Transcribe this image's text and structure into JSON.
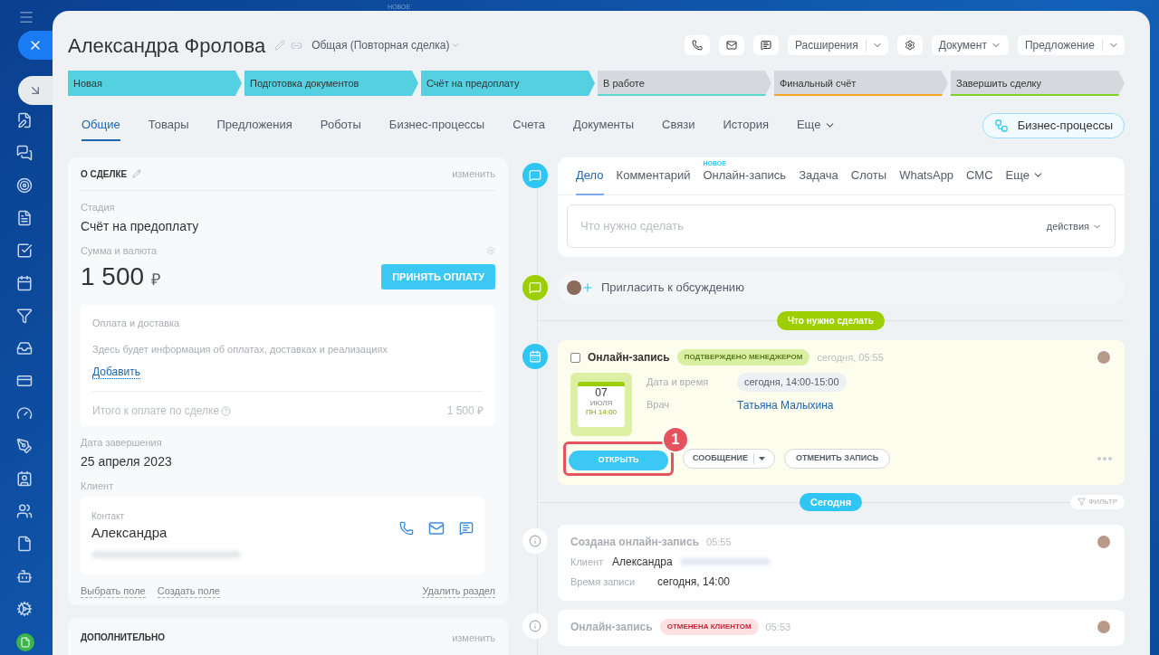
{
  "background_label": "НОВОЕ",
  "header": {
    "title": "Александра Фролова",
    "category": "Общая (Повторная сделка)",
    "toolbar": [
      {
        "kind": "icon"
      },
      {
        "kind": "icon"
      },
      {
        "kind": "icon"
      },
      {
        "kind": "split",
        "label": "Расширения"
      },
      {
        "kind": "icon"
      },
      {
        "kind": "dropdown",
        "label": "Документ"
      },
      {
        "kind": "split",
        "label": "Предложение"
      }
    ]
  },
  "stages": [
    {
      "label": "Новая",
      "passed": true,
      "color": "#55d0e0"
    },
    {
      "label": "Подготовка документов",
      "passed": true,
      "color": "#55d0e0"
    },
    {
      "label": "Счёт на предоплату",
      "passed": true,
      "color": "#55d0e0"
    },
    {
      "label": "В работе",
      "passed": false,
      "color": "#5ad8d0"
    },
    {
      "label": "Финальный счёт",
      "passed": false,
      "color": "#f5a623"
    },
    {
      "label": "Завершить сделку",
      "passed": false,
      "color": "#7ed321"
    }
  ],
  "tabs": [
    {
      "label": "Общие",
      "selected": true
    },
    {
      "label": "Товары",
      "selected": false
    },
    {
      "label": "Предложения",
      "selected": false
    },
    {
      "label": "Роботы",
      "selected": false
    },
    {
      "label": "Бизнес-процессы",
      "selected": false
    },
    {
      "label": "Счета",
      "selected": false
    },
    {
      "label": "Документы",
      "selected": false
    },
    {
      "label": "Связи",
      "selected": false
    },
    {
      "label": "История",
      "selected": false
    },
    {
      "label": "Еще",
      "selected": false,
      "kind": "more"
    }
  ],
  "process_button": "Бизнес-процессы",
  "about": {
    "title": "О СДЕЛКЕ",
    "edit_link": "изменить",
    "stage_label": "Стадия",
    "stage_value": "Счёт на предоплату",
    "amount_label": "Сумма и валюта",
    "amount": "1 500",
    "currency": "₽",
    "pay_button": "ПРИНЯТЬ ОПЛАТУ",
    "payment": {
      "title": "Оплата и доставка",
      "info": "Здесь будет информация об оплатах, доставках и реализациях",
      "add_link": "Добавить",
      "total_label": "Итого к оплате по сделке",
      "total": "1 500 ₽"
    },
    "close_date_label": "Дата завершения",
    "close_date": "25 апреля 2023",
    "client_label": "Клиент",
    "contact": {
      "label": "Контакт",
      "name": "Александра"
    },
    "footer_links": [
      "Выбрать поле",
      "Создать поле"
    ],
    "delete_link": "Удалить раздел"
  },
  "extra": {
    "title": "ДОПОЛНИТЕЛЬНО",
    "edit_link": "изменить"
  },
  "composer": {
    "tabs": [
      {
        "label": "Дело",
        "selected": true
      },
      {
        "label": "Комментарий",
        "selected": false
      },
      {
        "label": "Онлайн-запись",
        "selected": false,
        "badge": "НОВОЕ"
      },
      {
        "label": "Задача",
        "selected": false
      },
      {
        "label": "Слоты",
        "selected": false
      },
      {
        "label": "WhatsApp",
        "selected": false
      },
      {
        "label": "СМС",
        "selected": false
      },
      {
        "label": "Еще",
        "selected": false,
        "kind": "more"
      }
    ],
    "placeholder": "Что нужно сделать",
    "actions": "действия"
  },
  "invite": "Пригласить к обсуждению",
  "todo_divider": "Что нужно сделать",
  "activity": {
    "title": "Онлайн-запись",
    "checked": false,
    "status": {
      "label": "ПОДТВЕРЖДЕНО МЕНЕДЖЕРОМ",
      "kind": "confirmed"
    },
    "time": "сегодня, 05:55",
    "calendar": {
      "day": "07",
      "month": "ИЮЛЯ",
      "weekday": "ПН 14:00"
    },
    "fields": [
      {
        "label": "Дата и время",
        "value": "сегодня, 14:00-15:00",
        "kind": "chip"
      },
      {
        "label": "Врач",
        "value": "Татьяна Малыхина",
        "kind": "link"
      }
    ],
    "open_button": "ОТКРЫТЬ",
    "message_button": "СООБЩЕНИЕ",
    "cancel_button": "ОТМЕНИТЬ ЗАПИСЬ",
    "step": "1"
  },
  "today_divider": "Сегодня",
  "filter": "ФИЛЬТР",
  "history": [
    {
      "title": "Создана онлайн-запись",
      "time": "05:55",
      "rows": [
        {
          "label": "Клиент",
          "value": "Александра",
          "redacted": true
        },
        {
          "label": "Время записи",
          "value": "сегодня, 14:00",
          "redacted": false
        }
      ]
    },
    {
      "title": "Онлайн-запись",
      "status": {
        "label": "ОТМЕНЕНА КЛИЕНТОМ",
        "kind": "cancelled"
      },
      "time": "05:53"
    }
  ]
}
